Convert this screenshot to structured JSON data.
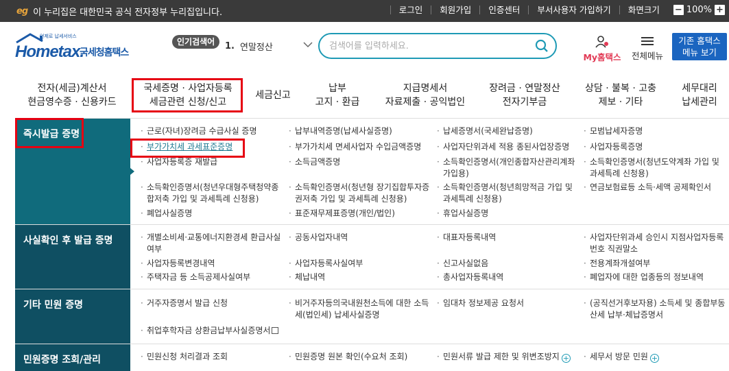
{
  "topbar": {
    "eg_mark": "eg",
    "notice": "이 누리집은 대한민국 공식 전자정부 누리집입니다.",
    "links": [
      "로그인",
      "회원가입",
      "인증센터",
      "부서사용자 가입하기",
      "화면크기"
    ],
    "zoom": "100%"
  },
  "header": {
    "logo_word": "Hometax.",
    "logo_kr": "국세청홈택스",
    "logo_tiny": "언제로 납세서비스",
    "hot_label": "인기검색어",
    "hot_num": "1.",
    "hot_text": "연말정산",
    "search_placeholder": "검색어를 입력하세요.",
    "myhome": "My홈택스",
    "allmenu": "전체메뉴",
    "oldhome_1": "기존 홈택스",
    "oldhome_2": "메뉴 보기"
  },
  "gnb": [
    {
      "l1": "전자(세금)계산서",
      "l2": "현금영수증 · 신용카드"
    },
    {
      "l1": "국세증명 · 사업자등록",
      "l2": "세금관련 신청/신고"
    },
    {
      "l1": "세금신고",
      "l2": ""
    },
    {
      "l1": "납부",
      "l2": "고지 · 환급"
    },
    {
      "l1": "지급명세서",
      "l2": "자료제출 · 공익법인"
    },
    {
      "l1": "장려금 · 연말정산",
      "l2": "전자기부금"
    },
    {
      "l1": "상담 · 불복 · 고충",
      "l2": "제보 · 기타"
    },
    {
      "l1": "세무대리",
      "l2": "납세관리"
    }
  ],
  "sections": {
    "instant": {
      "title": "즉시발급 증명",
      "items": [
        "근로(자녀)장려금 수급사실 증명",
        "납부내역증명(납세사실증명)",
        "납세증명서(국세완납증명)",
        "모범납세자증명",
        "부가가치세 과세표준증명",
        "부가가치세 면세사업자 수입금액증명",
        "사업자단위과세 적용 종된사업장증명",
        "사업자등록증명",
        "사업자등록증 재발급",
        "소득금액증명",
        "소득확인증명서(개인종합자산관리계좌 가입용)",
        "소득확인증명서(청년도약계좌 가입 및 과세특례 신청용)",
        "소득확인증명서(청년우대형주택청약종합저축 가입 및 과세특례 신청용)",
        "소득확인증명서(청년형 장기집합투자증권저축 가입 및 과세특례 신청용)",
        "소득확인증명서(청년희망적금 가입 및 과세특례 신청용)",
        "연금보험료등 소득·세액 공제확인서",
        "폐업사실증명",
        "표준재무제표증명(개인/법인)",
        "휴업사실증명"
      ]
    },
    "fact": {
      "title": "사실확인 후 발급 증명",
      "items": [
        "개별소비세·교통에너지환경세 환급사실여부",
        "공동사업자내역",
        "대표자등록내역",
        "사업자단위과세 승인시 지점사업자등록번호 직권말소",
        "사업자등록변경내역",
        "사업자등록사실여부",
        "신고사실없음",
        "전용계좌개설여부",
        "주택자금 등 소득공제사실여부",
        "체납내역",
        "총사업자등록내역",
        "폐업자에 대한 업종등의 정보내역"
      ]
    },
    "etc": {
      "title": "기타 민원 증명",
      "items": [
        "거주자증명서 발급 신청",
        "비거주자등의국내원천소득에 대한 소득세(법인세) 납세사실증명",
        "임대차 정보제공 요청서",
        "(공직선거후보자용) 소득세 및 종합부동산세 납부·체납증명서",
        "취업후학자금 상환금납부사실증명서"
      ]
    },
    "inquiry": {
      "title": "민원증명 조회/관리",
      "items": [
        "민원신청 처리결과 조회",
        "민원증명 원본 확인(수요처 조회)",
        "민원서류 발급 제한 및 위변조방지",
        "세무서 방문 민원"
      ]
    }
  }
}
